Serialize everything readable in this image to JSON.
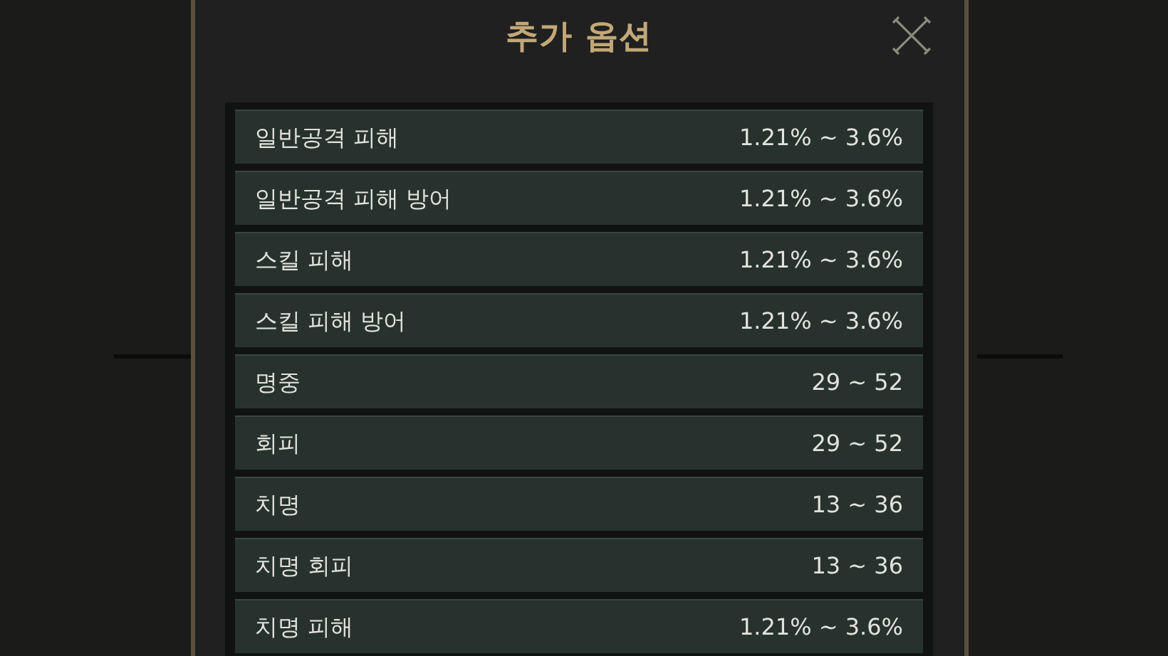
{
  "dialog": {
    "title": "추가 옵션"
  },
  "options": [
    {
      "name": "일반공격 피해",
      "range": "1.21% ~ 3.6%"
    },
    {
      "name": "일반공격 피해 방어",
      "range": "1.21% ~ 3.6%"
    },
    {
      "name": "스킬 피해",
      "range": "1.21% ~ 3.6%"
    },
    {
      "name": "스킬 피해 방어",
      "range": "1.21% ~ 3.6%"
    },
    {
      "name": "명중",
      "range": "29 ~ 52"
    },
    {
      "name": "회피",
      "range": "29 ~ 52"
    },
    {
      "name": "치명",
      "range": "13 ~ 36"
    },
    {
      "name": "치명 회피",
      "range": "13 ~ 36"
    },
    {
      "name": "치명 피해",
      "range": "1.21% ~ 3.6%"
    }
  ]
}
